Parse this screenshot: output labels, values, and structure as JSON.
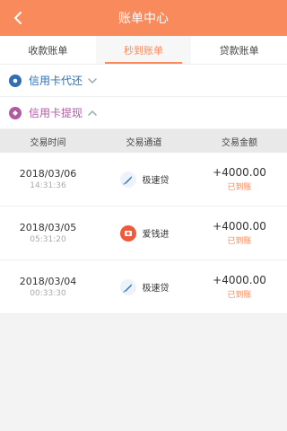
{
  "header": {
    "title": "账单中心"
  },
  "tabs": [
    {
      "label": "收款账单"
    },
    {
      "label": "秒到账单"
    },
    {
      "label": "贷款账单"
    }
  ],
  "sections": [
    {
      "label": "信用卡代还",
      "color": "#2f6fb2"
    },
    {
      "label": "信用卡提现",
      "color": "#b05aa2"
    }
  ],
  "table": {
    "headers": [
      "交易时间",
      "交易通道",
      "交易金额"
    ],
    "rows": [
      {
        "date": "2018/03/06",
        "time": "14:31:36",
        "channel": "极速贷",
        "channel_icon": "rocket-icon",
        "amount": "+4000.00",
        "status": "已到账"
      },
      {
        "date": "2018/03/05",
        "time": "05:31:20",
        "channel": "爱钱进",
        "channel_icon": "red-circle-logo-icon",
        "amount": "+4000.00",
        "status": "已到账"
      },
      {
        "date": "2018/03/04",
        "time": "00:33:30",
        "channel": "极速贷",
        "channel_icon": "rocket-icon",
        "amount": "+4000.00",
        "status": "已到账"
      }
    ]
  },
  "colors": {
    "accent": "#f98a5c"
  }
}
